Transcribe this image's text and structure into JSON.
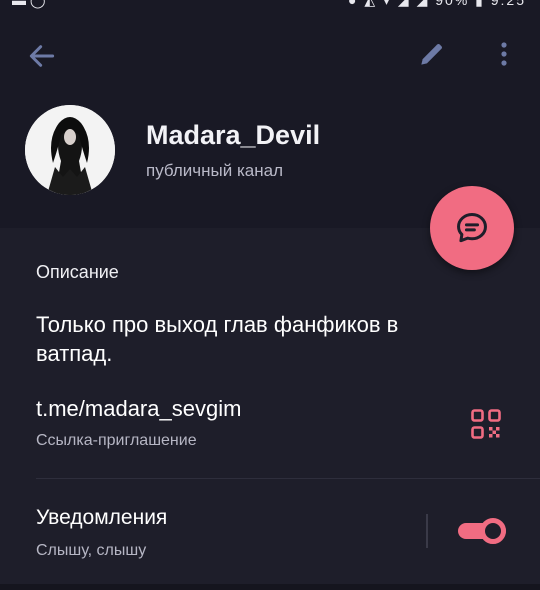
{
  "status_bar": {
    "left_text": "▬ ◯",
    "right_text": "● ◭ ▾ ◢ ◢ 90% ▮ 9:25"
  },
  "toolbar": {
    "back_icon": "arrow-left-icon",
    "edit_icon": "pencil-icon",
    "more_icon": "dots-vertical-icon"
  },
  "channel": {
    "name": "Madara_Devil",
    "type": "публичный канал"
  },
  "fab": {
    "icon": "chat-bubble-icon",
    "color": "#f16c82"
  },
  "description": {
    "label": "Описание",
    "text": "Только про выход глав фанфиков в ватпад."
  },
  "invite": {
    "link": "t.me/madara_sevgim",
    "label": "Ссылка-приглашение",
    "icon": "qr-code-icon"
  },
  "notifications": {
    "title": "Уведомления",
    "subtitle": "Слышу, слышу",
    "enabled": true
  },
  "colors": {
    "accent": "#f16c82",
    "header_bg": "#191925",
    "content_bg": "#1e1e2a"
  }
}
